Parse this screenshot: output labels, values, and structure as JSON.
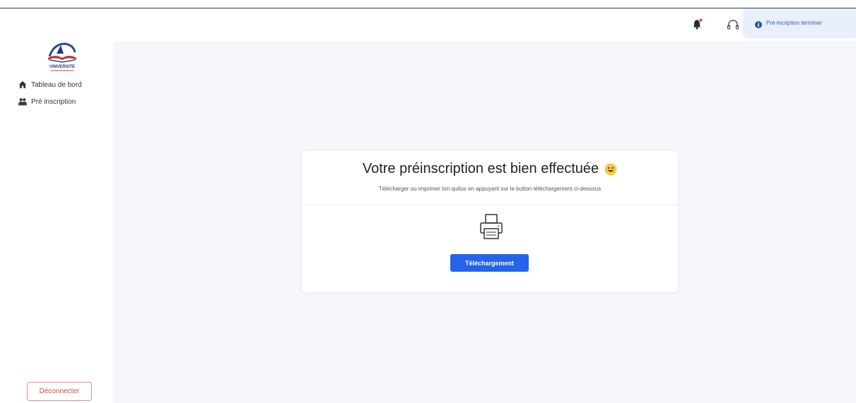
{
  "sidebar": {
    "logo_text": "UNIVERSITE",
    "items": [
      {
        "label": "Tableau de bord",
        "icon": "home-icon"
      },
      {
        "label": "Pré inscription",
        "icon": "users-icon"
      }
    ],
    "logout_label": "Déconnecter"
  },
  "header": {
    "bell_icon": "bell-icon",
    "bell_badge_color": "#e53935",
    "support_icon": "headset-icon"
  },
  "toast": {
    "icon": "info-icon",
    "message": "Pré-incription terminer"
  },
  "card": {
    "title": "Votre préinscription est bien effectuée",
    "title_emoji": "smiley-icon",
    "subtitle": "Télécharger ou imprimer ton quitus en appuyant sur le button téléchargement ci-dessous",
    "printer_icon": "printer-icon",
    "button_label": "Téléchargement"
  },
  "colors": {
    "accent": "#2563eb",
    "logout": "#d14b4b",
    "background": "#f5f7fb"
  }
}
